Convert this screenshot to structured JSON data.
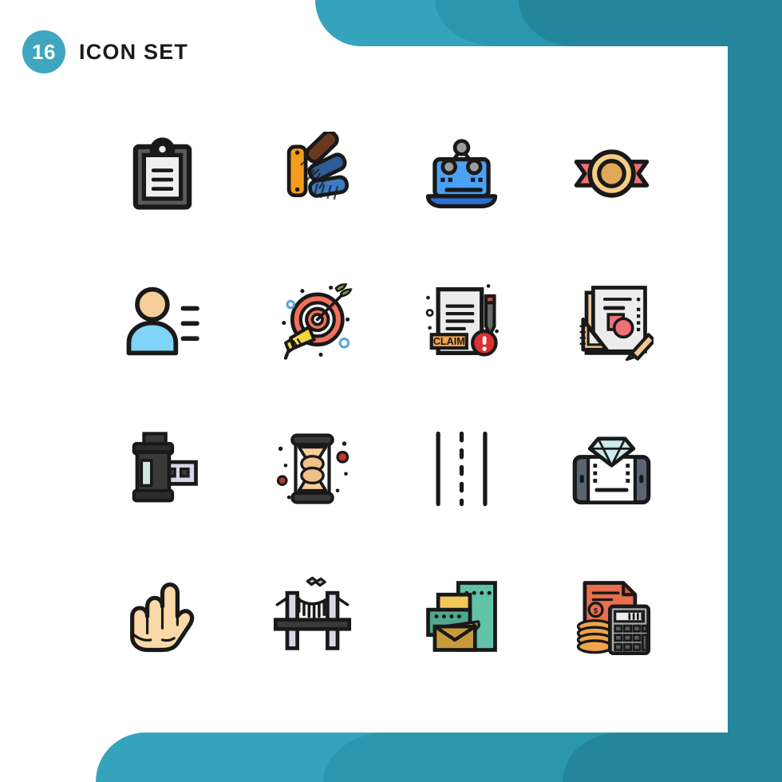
{
  "header": {
    "count": "16",
    "title": "ICON SET",
    "badge_color": "#3EA6BE"
  },
  "theme": {
    "background": "#FFFFFF",
    "deco_light": "#35A3BC",
    "deco_mid": "#2B97AE",
    "deco_dark": "#24869C",
    "outline": "#191919"
  },
  "grid": {
    "columns": 4,
    "rows": 4,
    "total": 16
  },
  "icons": [
    {
      "id": "clipboard",
      "name": "clipboard-icon",
      "label": "Clipboard",
      "row": 1,
      "col": 1,
      "colors": [
        "#5B5B5B",
        "#ECECEC",
        "#191919"
      ]
    },
    {
      "id": "color-swatches",
      "name": "color-swatches-icon",
      "label": "Color Swatches",
      "row": 1,
      "col": 2,
      "colors": [
        "#F59B1E",
        "#6B3A1E",
        "#2F5C97",
        "#3D7BC4"
      ]
    },
    {
      "id": "laptop-sitemap",
      "name": "laptop-sitemap-icon",
      "label": "Laptop Sitemap",
      "row": 1,
      "col": 3,
      "colors": [
        "#4BA0F5",
        "#2D6FD6",
        "#9C9C9C"
      ]
    },
    {
      "id": "medal-ribbon",
      "name": "medal-ribbon-icon",
      "label": "Medal Ribbon",
      "row": 1,
      "col": 4,
      "colors": [
        "#F5CE85",
        "#E0A857",
        "#F07070"
      ]
    },
    {
      "id": "user-list",
      "name": "user-profile-icon",
      "label": "User Profile",
      "row": 2,
      "col": 1,
      "colors": [
        "#F6CE9A",
        "#7FD4F7"
      ]
    },
    {
      "id": "target-megaphone",
      "name": "target-megaphone-icon",
      "label": "Target Marketing",
      "row": 2,
      "col": 2,
      "colors": [
        "#F2705C",
        "#E8E8E8",
        "#F4D73E",
        "#5BA7DE",
        "#6FA84A"
      ]
    },
    {
      "id": "claim-document",
      "name": "claim-document-icon",
      "label": "Claim Document",
      "row": 2,
      "col": 3,
      "colors": [
        "#ECECEC",
        "#F0A34C",
        "#DE2F2F",
        "#6B6B6B"
      ],
      "badge_text": "CLAIM"
    },
    {
      "id": "design-draft",
      "name": "design-draft-icon",
      "label": "Design Draft",
      "row": 2,
      "col": 4,
      "colors": [
        "#ECECEC",
        "#F6C98A",
        "#F0707A",
        "#E8C89A"
      ]
    },
    {
      "id": "film-roll",
      "name": "film-roll-icon",
      "label": "Film Roll",
      "row": 3,
      "col": 1,
      "colors": [
        "#3A3A3A",
        "#2B2B2B",
        "#CFE8E4",
        "#D7D7E8"
      ]
    },
    {
      "id": "hourglass",
      "name": "hourglass-icon",
      "label": "Hourglass",
      "row": 3,
      "col": 2,
      "colors": [
        "#3A3A3A",
        "#F6CE9A",
        "#C0392B"
      ]
    },
    {
      "id": "road-lanes",
      "name": "road-lanes-icon",
      "label": "Road Lanes",
      "row": 3,
      "col": 3,
      "colors": [
        "#191919"
      ]
    },
    {
      "id": "phone-diamond",
      "name": "phone-diamond-icon",
      "label": "Mobile Diamond",
      "row": 3,
      "col": 4,
      "colors": [
        "#5B6475",
        "#FFFFFF",
        "#CDEAEE"
      ]
    },
    {
      "id": "hand-gesture",
      "name": "hand-gesture-icon",
      "label": "Hand Gesture",
      "row": 4,
      "col": 1,
      "colors": [
        "#FAD9A8"
      ]
    },
    {
      "id": "suspension-bridge",
      "name": "suspension-bridge-icon",
      "label": "Suspension Bridge",
      "row": 4,
      "col": 2,
      "colors": [
        "#D7D7E8",
        "#3A3A3A",
        "#9FB8C9"
      ]
    },
    {
      "id": "email-compose",
      "name": "email-compose-icon",
      "label": "Email Compose",
      "row": 4,
      "col": 3,
      "colors": [
        "#62C2A8",
        "#F2C85B",
        "#C79A3B",
        "#4FA88E"
      ]
    },
    {
      "id": "accounting",
      "name": "accounting-icon",
      "label": "Accounting Calculator",
      "row": 4,
      "col": 4,
      "colors": [
        "#E8704F",
        "#F0A34C",
        "#A8A8A8",
        "#5B5B5B"
      ]
    }
  ]
}
